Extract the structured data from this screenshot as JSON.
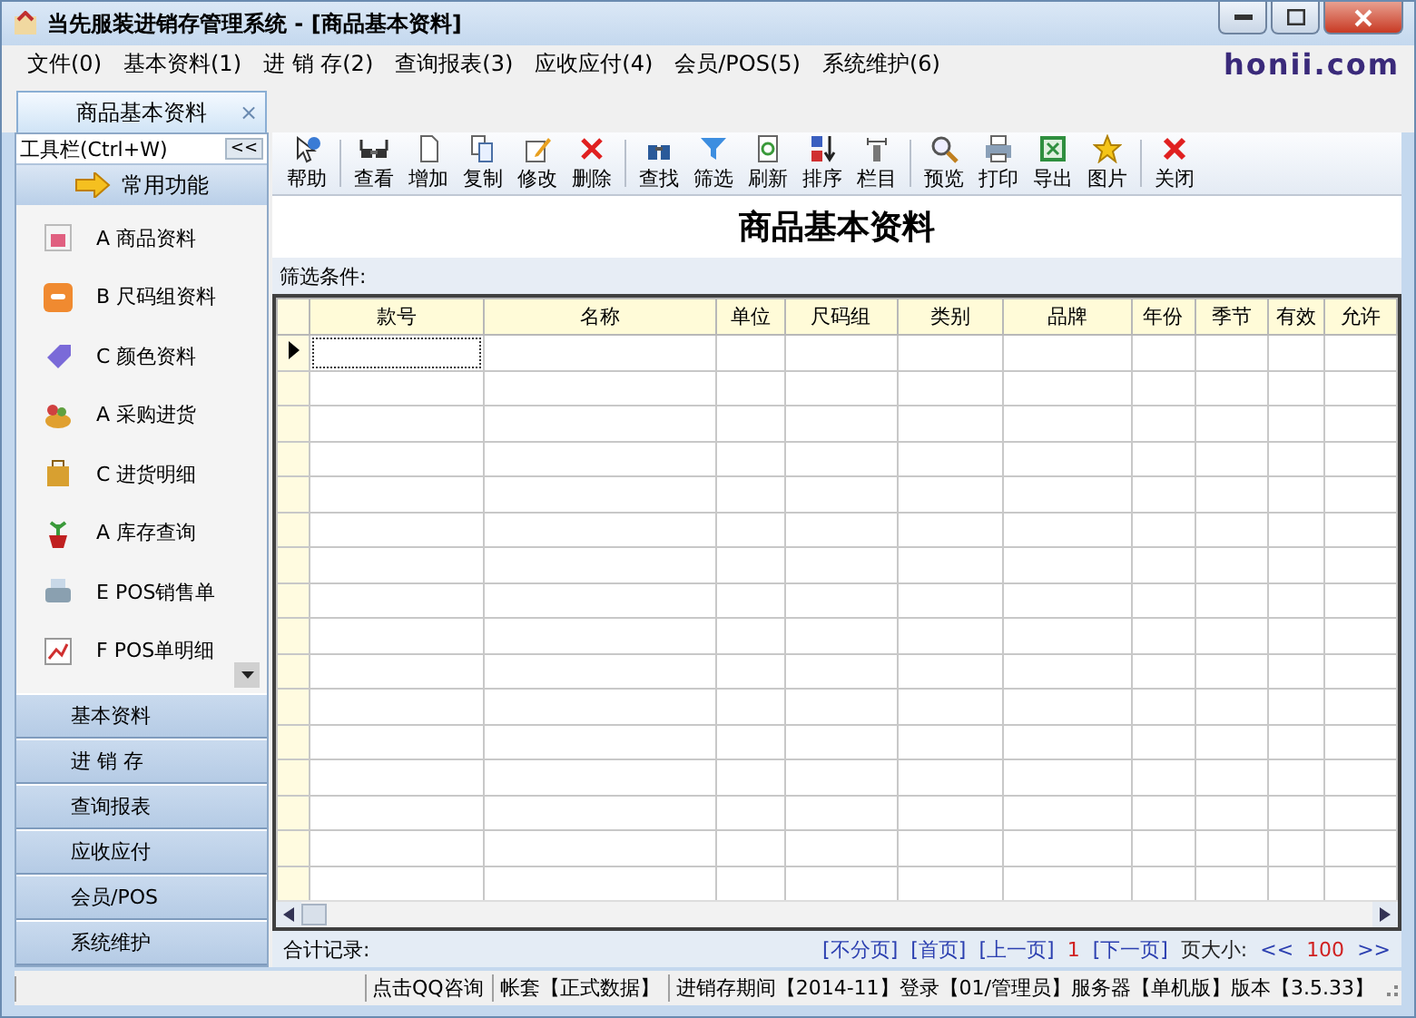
{
  "window": {
    "title": "当先服装进销存管理系统 - [商品基本资料]",
    "logo": "honii.com"
  },
  "menu": [
    "文件(0)",
    "基本资料(1)",
    "进 销 存(2)",
    "查询报表(3)",
    "应收应付(4)",
    "会员/POS(5)",
    "系统维护(6)"
  ],
  "tabs": [
    {
      "label": "商品基本资料",
      "selected": true,
      "close": "×"
    }
  ],
  "sidebar": {
    "title": "工具栏(Ctrl+W)",
    "collapse": "<<",
    "section": "常用功能",
    "items": [
      {
        "label": "A 商品资料"
      },
      {
        "label": "B 尺码组资料"
      },
      {
        "label": "C 颜色资料"
      },
      {
        "label": "A 采购进货"
      },
      {
        "label": "C 进货明细"
      },
      {
        "label": "A 库存查询"
      },
      {
        "label": "E POS销售单"
      },
      {
        "label": "F POS单明细"
      }
    ],
    "nav": [
      "基本资料",
      "进 销 存",
      "查询报表",
      "应收应付",
      "会员/POS",
      "系统维护"
    ]
  },
  "toolbar": [
    [
      "帮助"
    ],
    [
      "查看",
      "增加",
      "复制",
      "修改",
      "删除"
    ],
    [
      "查找",
      "筛选",
      "刷新",
      "排序",
      "栏目"
    ],
    [
      "预览",
      "打印",
      "导出",
      "图片"
    ],
    [
      "关闭"
    ]
  ],
  "page_title": "商品基本资料",
  "filter_label": "筛选条件:",
  "table": {
    "columns": [
      "款号",
      "名称",
      "单位",
      "尺码组",
      "类别",
      "品牌",
      "年份",
      "季节",
      "有效",
      "允许"
    ],
    "rows": [
      {
        "current": true
      },
      {
        "current": false
      },
      {
        "current": false
      },
      {
        "current": false
      },
      {
        "current": false
      },
      {
        "current": false
      },
      {
        "current": false
      },
      {
        "current": false
      },
      {
        "current": false
      },
      {
        "current": false
      },
      {
        "current": false
      },
      {
        "current": false
      },
      {
        "current": false
      },
      {
        "current": false
      },
      {
        "current": false
      },
      {
        "current": false
      }
    ]
  },
  "footer": {
    "total_label": "合计记录:",
    "pager": [
      {
        "label": "[不分页]",
        "kind": "link"
      },
      {
        "label": "[首页]",
        "kind": "link"
      },
      {
        "label": "[上一页]",
        "kind": "link"
      },
      {
        "label": "1",
        "kind": "page"
      },
      {
        "label": "[下一页]",
        "kind": "link"
      },
      {
        "label": "页大小:",
        "kind": "text"
      },
      {
        "label": "<<",
        "kind": "link"
      },
      {
        "label": "100",
        "kind": "page"
      },
      {
        "label": ">>",
        "kind": "link"
      }
    ]
  },
  "status_bar": [
    "点击QQ咨询",
    "帐套【正式数据】",
    "进销存期间【2014-11】登录【01/管理员】服务器【单机版】版本【3.5.33】"
  ]
}
